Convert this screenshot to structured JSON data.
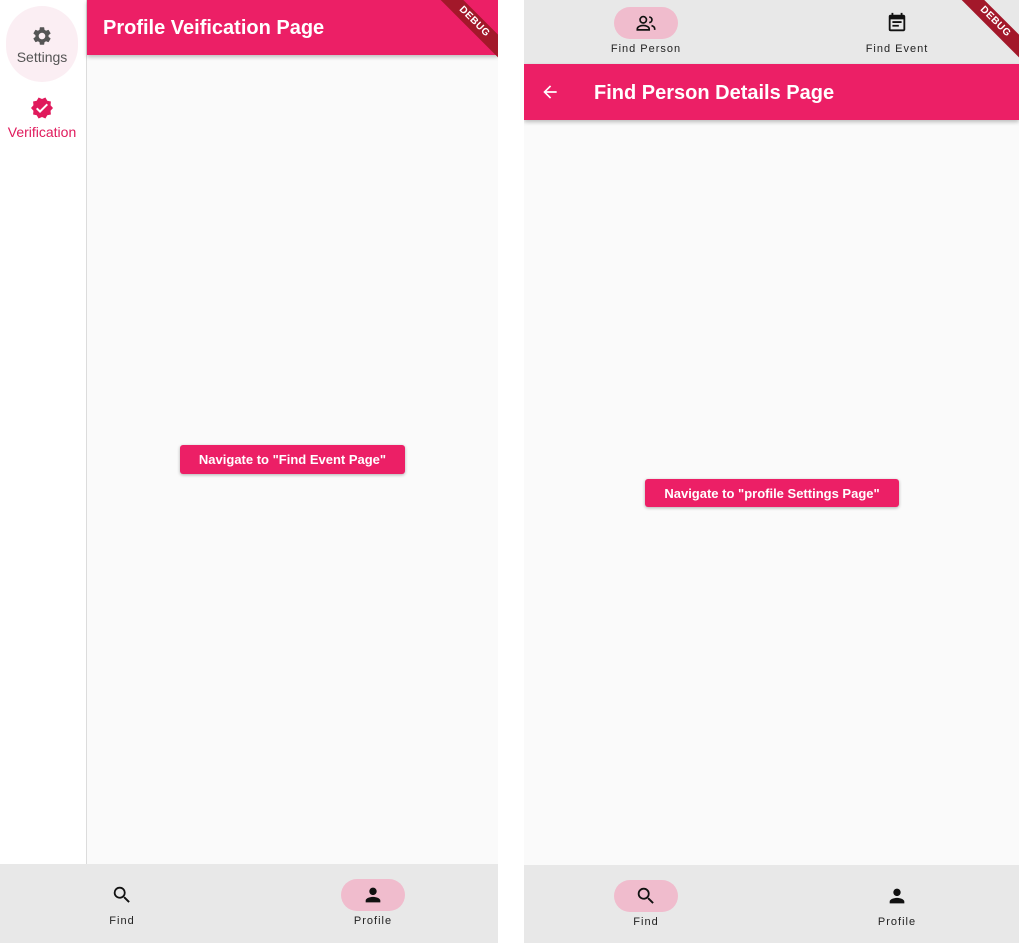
{
  "left": {
    "rail": {
      "items": [
        {
          "label": "Settings",
          "icon": "gear-icon",
          "color": "#555555"
        },
        {
          "label": "Verification",
          "icon": "verified-badge-icon",
          "color": "#e01a5c"
        }
      ]
    },
    "appbar_title": "Profile Veification Page",
    "debug_label": "DEBUG",
    "center_button": "Navigate to \"Find Event Page\"",
    "bottom_nav": [
      {
        "label": "Find",
        "icon": "search-icon"
      },
      {
        "label": "Profile",
        "icon": "person-icon"
      }
    ]
  },
  "right": {
    "top_nav": [
      {
        "label": "Find Person",
        "icon": "people-icon"
      },
      {
        "label": "Find Event",
        "icon": "event-note-icon"
      }
    ],
    "debug_label": "DEBUG",
    "appbar_title": "Find Person Details Page",
    "back_icon": "back-arrow-icon",
    "center_button": "Navigate to \"profile Settings Page\"",
    "bottom_nav": [
      {
        "label": "Find",
        "icon": "search-icon"
      },
      {
        "label": "Profile",
        "icon": "person-icon"
      }
    ]
  },
  "colors": {
    "primary": "#ec1f66",
    "selected_indicator": "#f0bccd",
    "nav_background": "#e8e8e8",
    "page_background": "#fafafa",
    "debug_ribbon": "#a3182a"
  }
}
